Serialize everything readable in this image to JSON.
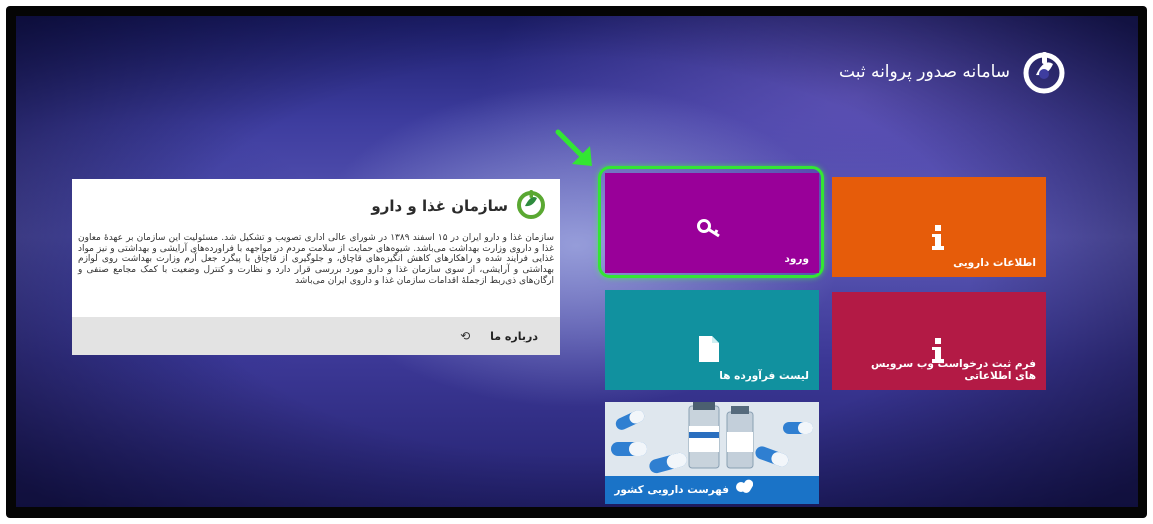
{
  "header": {
    "title": "سامانه صدور پروانه ثبت"
  },
  "about_card": {
    "title": "سازمان غذا و دارو",
    "body": "سازمان غذا و دارو ایران در ۱۵ اسفند ۱۳۸۹ در شورای عالی اداری تصویب و تشکیل شد. مسئولیت این سازمان بر عهدهٔ معاون غذا و داروی وزارت بهداشت می‌باشد. شیوه‌های حمایت از سلامت مردم در مواجهه با فراورده‌های آرایشی و بهداشتی و نیز مواد غذایی فرایند شده و راهکارهای کاهش انگیزه‌های قاچاق، و جلوگیری از قاچاق با پیگرد جعل آرم وزارت بهداشت روی لوازم بهداشتی و آرایشی، از سوی سازمان غذا و دارو مورد بررسی قرار دارد و نظارت و کنترل وضعیت با کمک مجامع صنفی و ارگان‌های ذی‌ربط ازجملهٔ اقدامات سازمان غذا و داروی ایران می‌باشد",
    "about_link": "درباره ما"
  },
  "tiles": {
    "login": {
      "label": "ورود",
      "icon": "key-icon",
      "color": "#990099"
    },
    "drug_info": {
      "label": "اطلاعات دارویی",
      "icon": "info-icon",
      "color": "#e65c0a"
    },
    "product_list": {
      "label": "لیست فرآورده ها",
      "icon": "document-icon",
      "color": "#11919f"
    },
    "request_form": {
      "label": "فرم ثبت درخواست وب سرویس های اطلاعاتی",
      "icon": "info-icon",
      "color": "#b31a45"
    },
    "national_list": {
      "label": "فهرست دارویی کشور",
      "icon": "pills-icon",
      "color": "#1a73c7"
    }
  },
  "annotation": {
    "arrow": "green-arrow-icon",
    "highlight_color": "#33e633"
  }
}
